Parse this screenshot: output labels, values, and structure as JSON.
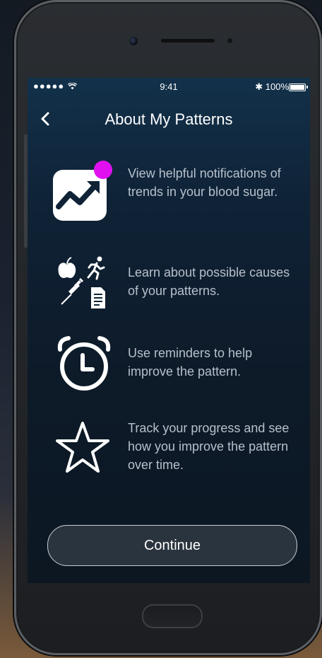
{
  "status_bar": {
    "signal": "●●●●● ",
    "time": "9:41",
    "battery": "100%"
  },
  "nav": {
    "title": "About My Patterns"
  },
  "features": [
    {
      "icon": "trend-chart-icon",
      "text": "View helpful notifications of trends in your blood sugar."
    },
    {
      "icon": "causes-icon",
      "text": "Learn about possible causes of your patterns."
    },
    {
      "icon": "alarm-clock-icon",
      "text": "Use reminders to help improve the pattern."
    },
    {
      "icon": "star-icon",
      "text": "Track your progress and see how you improve the pattern over time."
    }
  ],
  "continue_label": "Continue",
  "colors": {
    "notification_dot": "#e010f0",
    "screen_top": "#12314a",
    "text_muted": "#b7c0cb"
  }
}
